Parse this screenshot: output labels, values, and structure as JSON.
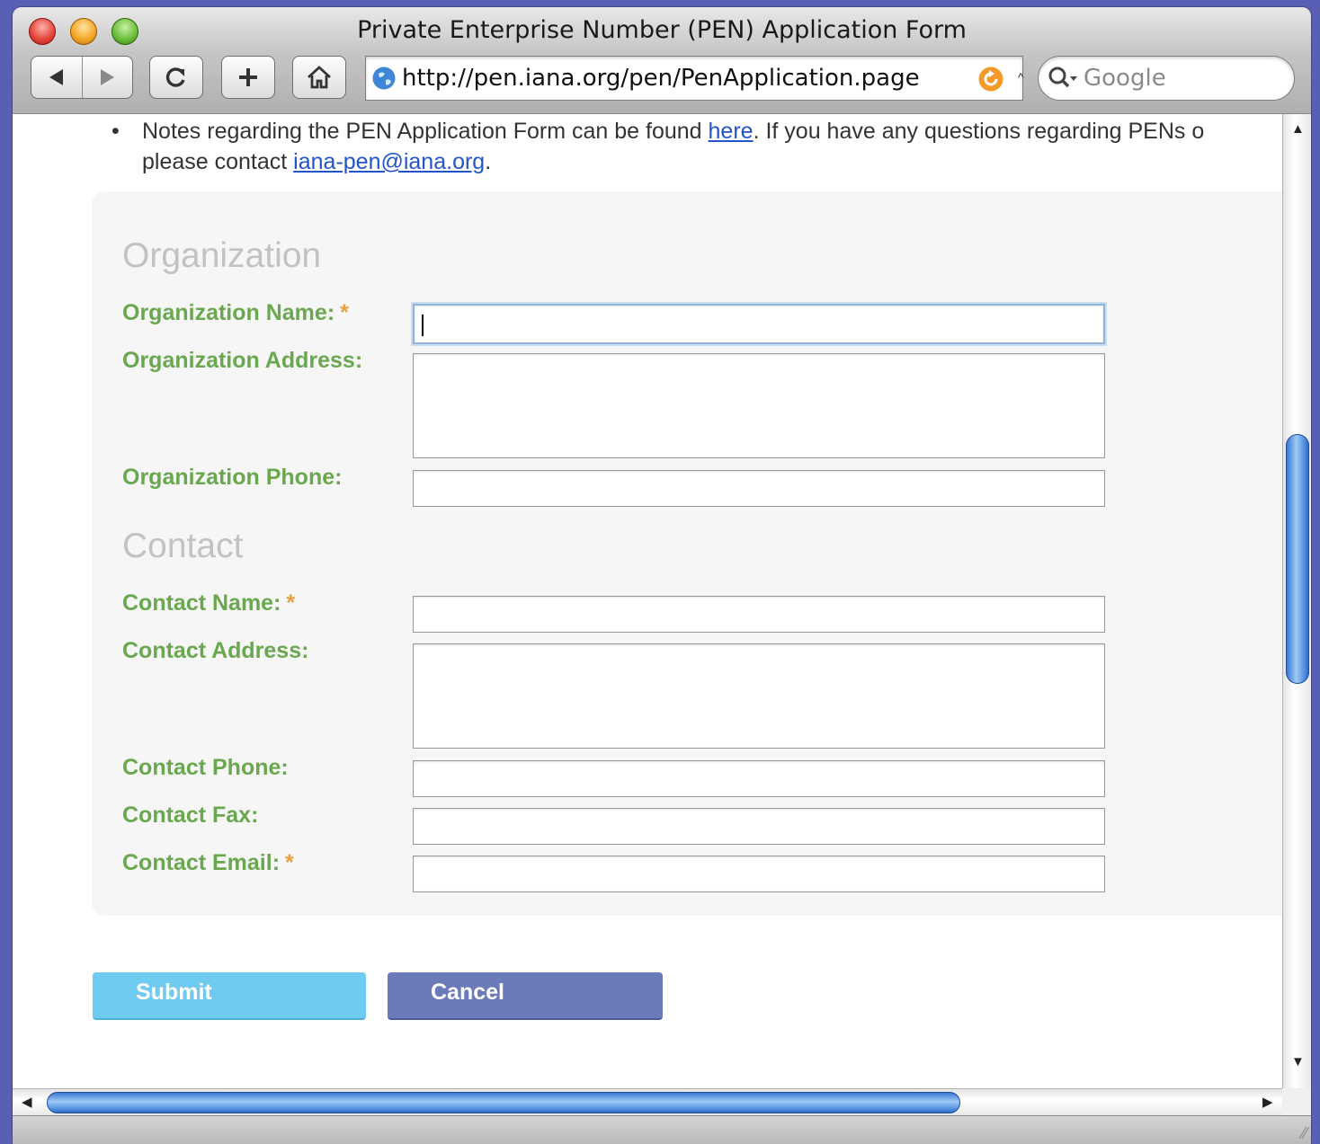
{
  "window": {
    "title": "Private Enterprise Number (PEN) Application Form"
  },
  "toolbar": {
    "url": "http://pen.iana.org/pen/PenApplication.page",
    "search_placeholder": "Google",
    "back_icon": "back-arrow-icon",
    "forward_icon": "forward-arrow-icon",
    "reload_icon": "reload-icon",
    "add_icon": "plus-icon",
    "home_icon": "home-icon"
  },
  "notes": {
    "bullet": "•",
    "text_before_link": "Notes regarding the PEN Application Form can be found ",
    "link_here": "here",
    "text_after_link": ". If you have any questions regarding PENs o",
    "line2_prefix": "please contact ",
    "email_link": "iana-pen@iana.org",
    "line2_suffix": "."
  },
  "sections": {
    "organization": "Organization",
    "contact": "Contact"
  },
  "fields": {
    "org_name": "Organization Name:",
    "org_address": "Organization Address:",
    "org_phone": "Organization Phone:",
    "contact_name": "Contact Name:",
    "contact_address": "Contact Address:",
    "contact_phone": "Contact Phone:",
    "contact_fax": "Contact Fax:",
    "contact_email": "Contact Email:",
    "required_marker": "*"
  },
  "buttons": {
    "submit": "Submit",
    "cancel": "Cancel"
  },
  "colors": {
    "label_green": "#6aa84f",
    "required_orange": "#e8a040",
    "submit_blue": "#6fcbef",
    "cancel_blue": "#6b7ab8"
  }
}
